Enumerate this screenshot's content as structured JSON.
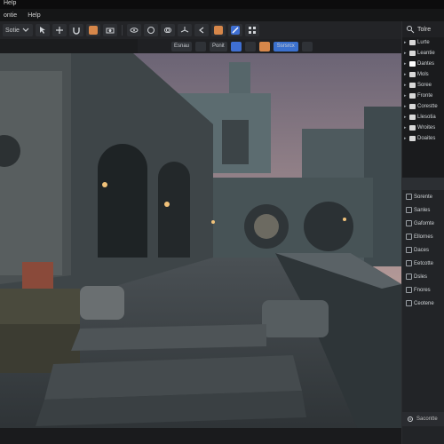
{
  "app": {
    "window_title": "Help"
  },
  "menubar": {
    "items": [
      "ontie",
      "Help"
    ]
  },
  "toolbar": {
    "mode_label": "Sotie",
    "icons": [
      "mode-dropdown",
      "select-arrow",
      "transform",
      "snap",
      "orange-tool",
      "camera",
      "view-toggle",
      "proportional",
      "overlay",
      "gizmo",
      "arrow-back",
      "orange-cube",
      "blue-pen",
      "more"
    ]
  },
  "subbar": {
    "items": [
      "Esnau",
      "Ponit"
    ],
    "viewport_shading": "Ssrsrcx"
  },
  "outliner": {
    "header": "Tolre",
    "items": [
      "Lurte",
      "Leantie",
      "Dantes",
      "Mols",
      "Soree",
      "Fronte",
      "Corestte",
      "Llesotia",
      "Wroites",
      "Doaites"
    ]
  },
  "properties": {
    "items": [
      "Sorente",
      "Sanles",
      "Gafomte",
      "Ellornes",
      "Daces",
      "Eetcotte",
      "Dsles",
      "Fnores",
      "Ceotene"
    ],
    "footer": "Sacontte"
  },
  "colors": {
    "background": "#1b1c1e",
    "panel": "#1a1b1d",
    "accent_orange": "#d7874a",
    "accent_blue": "#3f6fd2",
    "text": "#c9ccd1"
  }
}
